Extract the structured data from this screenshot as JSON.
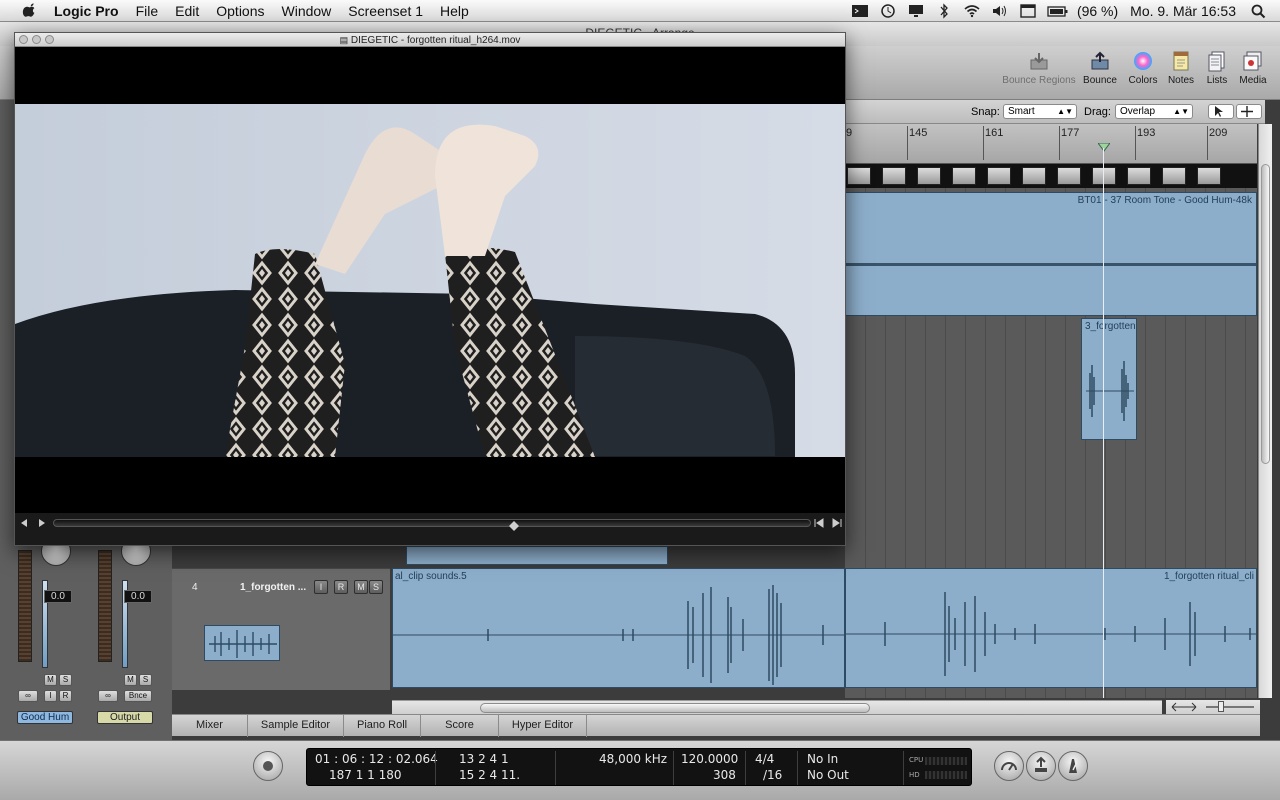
{
  "menubar": {
    "app": "Logic Pro",
    "items": [
      "File",
      "Edit",
      "Options",
      "Window",
      "Screenset 1",
      "Help"
    ],
    "battery": "(96 %)",
    "datetime": "Mo. 9. Mär 16:53"
  },
  "arrange": {
    "title": "DIEGETIC - Arrange"
  },
  "toolbar": {
    "bounce_regions": "Bounce Regions",
    "bounce": "Bounce",
    "colors": "Colors",
    "notes": "Notes",
    "lists": "Lists",
    "media": "Media"
  },
  "snapbar": {
    "snap_label": "Snap:",
    "snap_value": "Smart",
    "drag_label": "Drag:",
    "drag_value": "Overlap"
  },
  "ruler": {
    "bars": [
      "9",
      "145",
      "161",
      "177",
      "193",
      "209"
    ]
  },
  "regions": {
    "room_tone": "BT01 - 37 Room Tone - Good Hum-48k",
    "forgotten3": "3_forgotten",
    "clip_sounds": "al_clip sounds.5",
    "forgotten1": "1_forgotten ritual_cli"
  },
  "track4": {
    "number": "4",
    "name": "1_forgotten ...",
    "btn_i": "I",
    "btn_r": "R",
    "btn_m": "M",
    "btn_s": "S"
  },
  "inspector": {
    "strip1": {
      "value": "0.0",
      "name": "Good Hum",
      "m": "M",
      "s": "S",
      "i": "I",
      "r": "R"
    },
    "strip2": {
      "value": "0.0",
      "name": "Output",
      "m": "M",
      "s": "S",
      "bnce": "Bnce"
    }
  },
  "editor_tabs": [
    "Mixer",
    "Sample Editor",
    "Piano Roll",
    "Score",
    "Hyper Editor"
  ],
  "transport": {
    "smpte": "01 : 06 : 12 : 02.064",
    "bars_pos": "187   1   1  180",
    "bar_a": "13    2    4     1",
    "bar_b": "15    2    4    11.",
    "sample_rate": "48,000 kHz",
    "tempo": "120.0000",
    "tempo_sub": "308",
    "signature": "4/4",
    "division": "/16",
    "in": "No In",
    "out": "No Out",
    "cpu": "CPU",
    "hd": "HD"
  },
  "video": {
    "title": "DIEGETIC - forgotten ritual_h264.mov",
    "playhead_fraction": 0.61
  },
  "colors": {
    "region_blue": "#8daecb",
    "good_hum_label": "#8fb8e0",
    "output_label": "#d8d9a8"
  }
}
